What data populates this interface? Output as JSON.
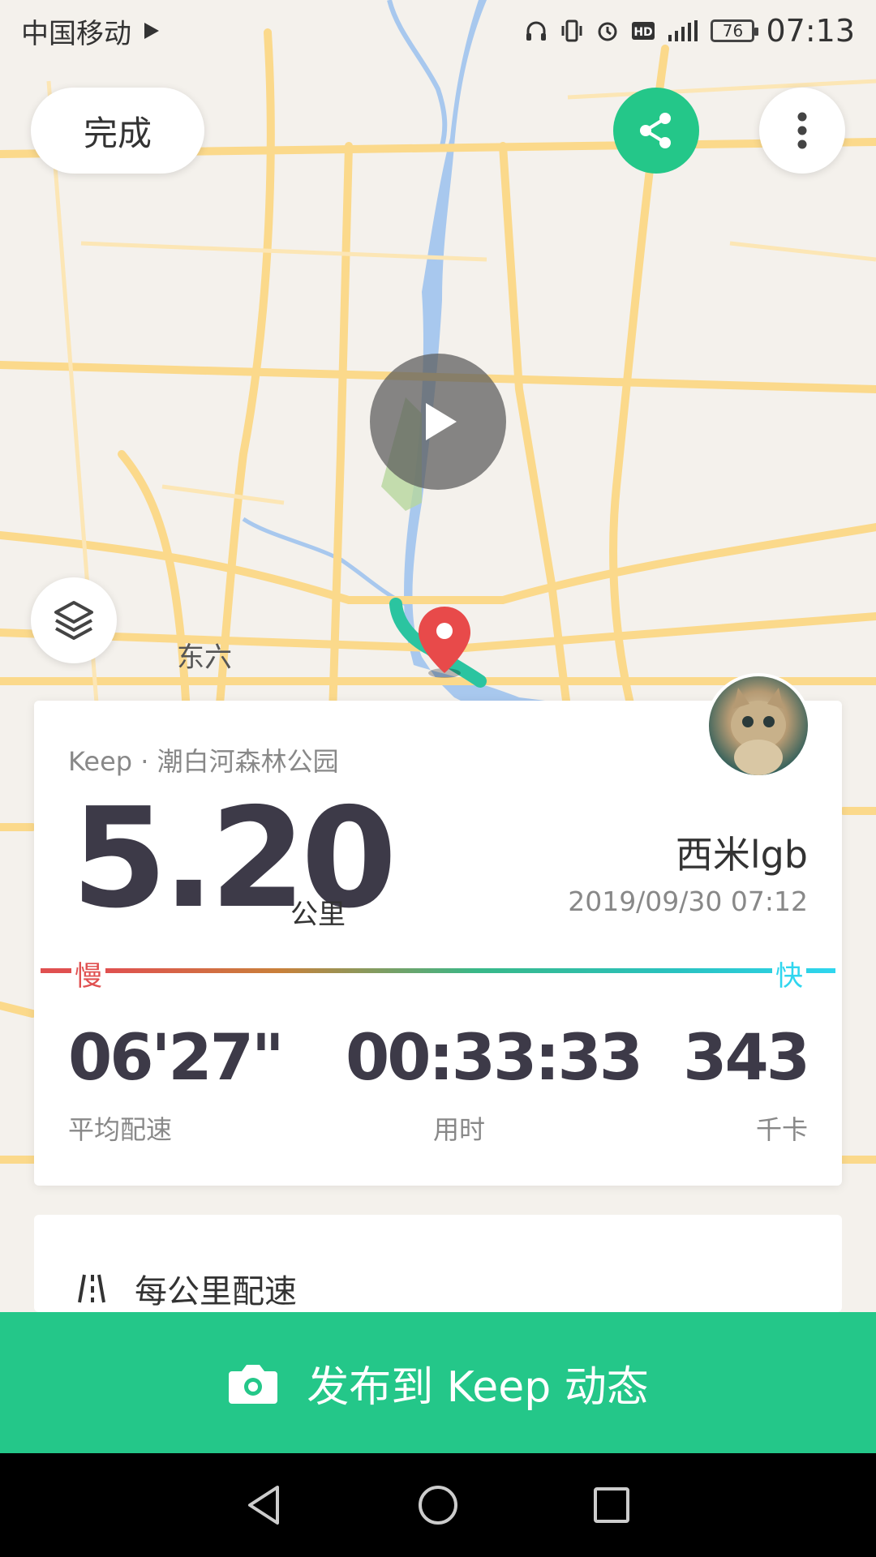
{
  "status_bar": {
    "carrier": "中国移动",
    "battery": "76",
    "time": "07:13"
  },
  "header": {
    "done_label": "完成"
  },
  "map": {
    "label": "东六"
  },
  "card": {
    "source": "Keep · 潮白河森林公园",
    "distance": "5.20",
    "distance_unit": "公里",
    "username": "西米lgb",
    "datetime": "2019/09/30 07:12",
    "slow_label": "慢",
    "fast_label": "快",
    "stats": [
      {
        "value": "06'27\"",
        "label": "平均配速"
      },
      {
        "value": "00:33:33",
        "label": "用时"
      },
      {
        "value": "343",
        "label": "千卡"
      }
    ]
  },
  "pace_section": {
    "title": "每公里配速"
  },
  "publish": {
    "label": "发布到 Keep 动态"
  },
  "colors": {
    "accent": "#24c789",
    "slow": "#e05050",
    "fast": "#2fd6ef"
  }
}
